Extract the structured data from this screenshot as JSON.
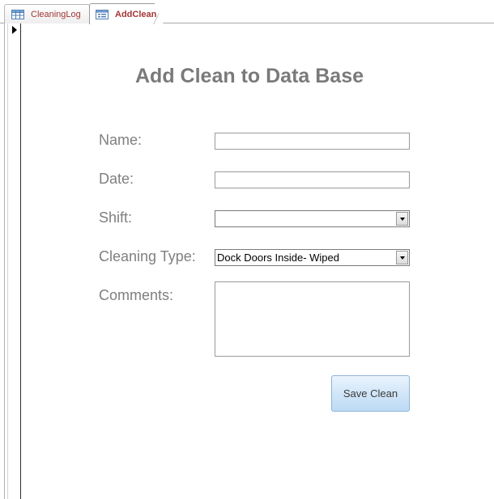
{
  "tabs": [
    {
      "label": "CleaningLog",
      "icon": "table-icon",
      "active": false
    },
    {
      "label": "AddClean",
      "icon": "form-icon",
      "active": true
    }
  ],
  "form": {
    "title": "Add Clean to Data Base",
    "name_label": "Name:",
    "name_value": "",
    "date_label": "Date:",
    "date_value": "",
    "shift_label": "Shift:",
    "shift_value": "",
    "cleaning_type_label": "Cleaning Type:",
    "cleaning_type_value": "Dock Doors Inside- Wiped",
    "comments_label": "Comments:",
    "comments_value": "",
    "save_label": "Save Clean"
  },
  "colors": {
    "tab_text": "#a23535",
    "label_text": "#7f7f7f",
    "title_text": "#7a7a7a",
    "button_bg": "#d2e6f8"
  }
}
